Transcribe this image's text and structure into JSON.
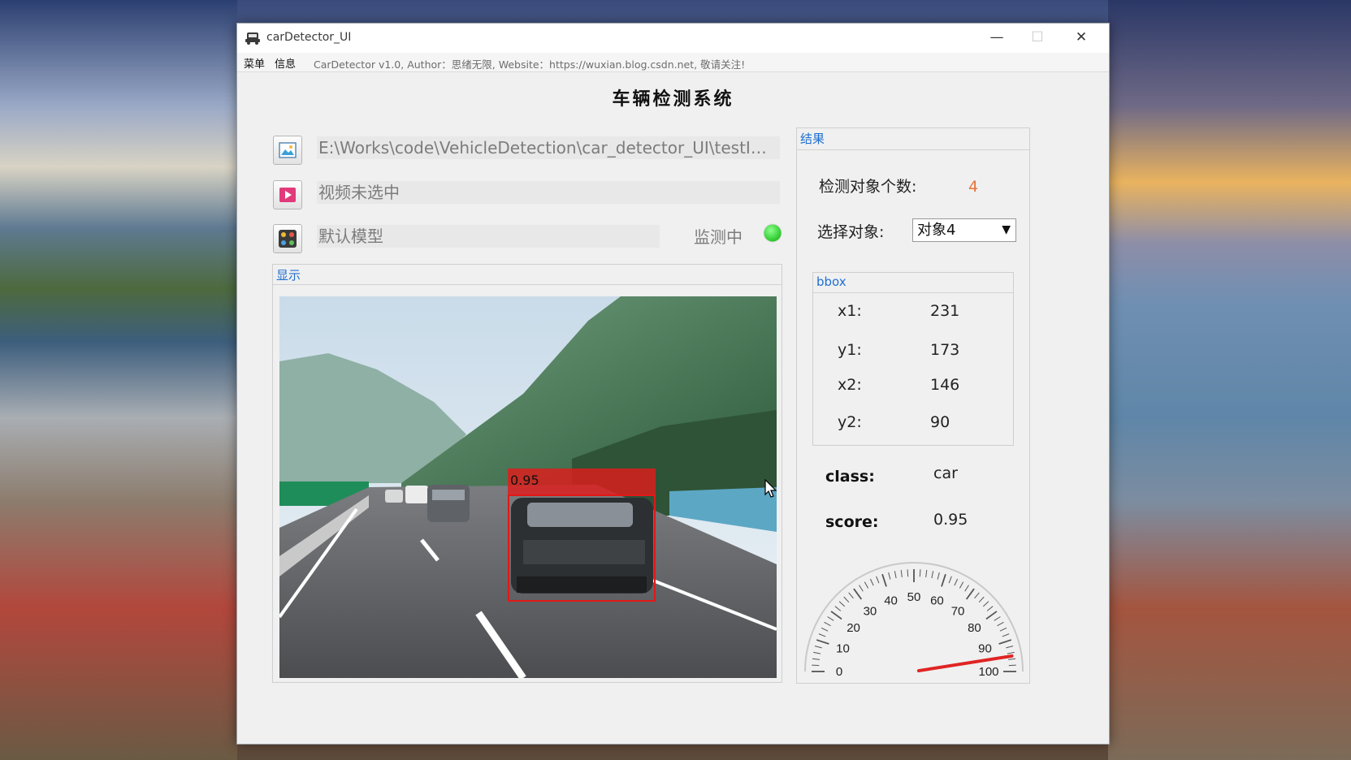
{
  "window": {
    "title": "carDetector_UI",
    "minimize_glyph": "—",
    "maximize_glyph": "☐",
    "close_glyph": "✕"
  },
  "menu": {
    "items": [
      "菜单",
      "信息"
    ],
    "info_text": "CarDetector v1.0, Author：思绪无限, Website：https://wuxian.blog.csdn.net, 敬请关注!"
  },
  "heading": "车辆检测系统",
  "inputs": {
    "image_path": "E:\\Works\\code\\VehicleDetection\\car_detector_UI\\testImage\\...",
    "video_path": "视频未选中",
    "model": "默认模型",
    "status": "监测中",
    "status_color": "#22c322"
  },
  "display_panel": {
    "title": "显示",
    "detection_label": "0.95"
  },
  "results": {
    "title": "结果",
    "count_label": "检测对象个数:",
    "count_value": "4",
    "select_label": "选择对象:",
    "select_value": "对象4",
    "bbox": {
      "title": "bbox",
      "x1_label": "x1:",
      "x1": "231",
      "y1_label": "y1:",
      "y1": "173",
      "x2_label": "x2:",
      "x2": "146",
      "y2_label": "y2:",
      "y2": "90"
    },
    "class_label": "class:",
    "class_value": "car",
    "score_label": "score:",
    "score_value": "0.95"
  },
  "gauge": {
    "tick_labels": [
      "0",
      "10",
      "20",
      "30",
      "40",
      "50",
      "60",
      "70",
      "80",
      "90",
      "100"
    ],
    "value": 95,
    "needle_color": "#e02424"
  },
  "icons": {
    "app": "car-icon",
    "image": "image-file-icon",
    "video": "video-play-icon",
    "model": "model-grid-icon"
  }
}
